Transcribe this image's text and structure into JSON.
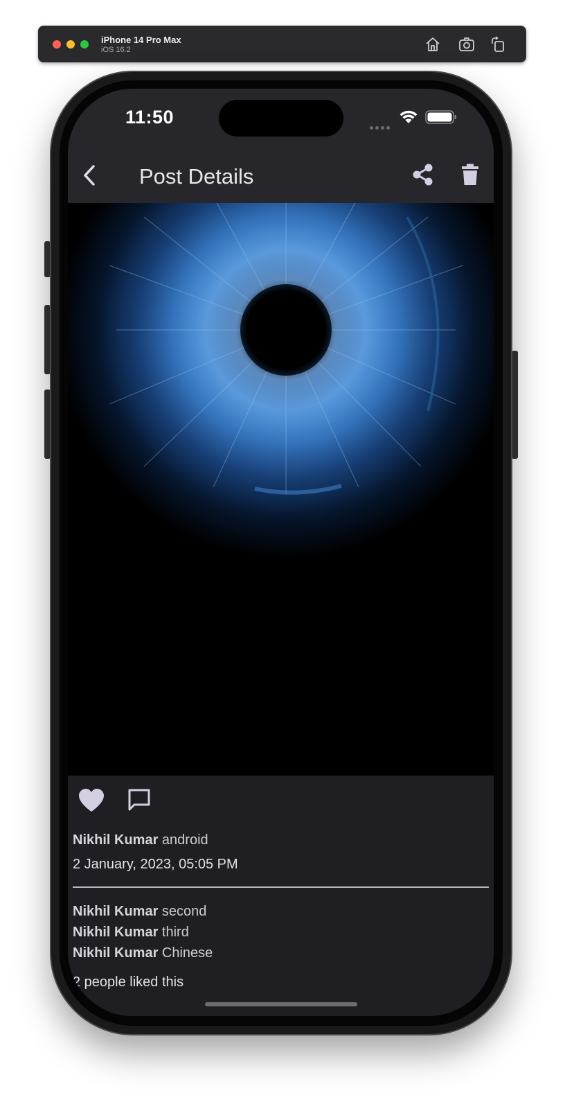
{
  "simulator": {
    "device_name": "iPhone 14 Pro Max",
    "os_version": "iOS 16.2",
    "buttons": [
      "home-icon",
      "screenshot-icon",
      "rotate-icon"
    ]
  },
  "status_bar": {
    "time": "11:50",
    "icons": [
      "cellular-icon",
      "wifi-icon",
      "battery-icon"
    ]
  },
  "app_bar": {
    "title": "Post Details",
    "back_icon": "chevron-left-icon",
    "actions": [
      "share-icon",
      "trash-icon"
    ]
  },
  "post": {
    "image": "blue-eye-iris-image",
    "author": "Nikhil Kumar",
    "caption": "android",
    "date": "2 January, 2023, 05:05 PM",
    "comments": [
      {
        "author": "Nikhil Kumar",
        "text": "second"
      },
      {
        "author": "Nikhil Kumar",
        "text": "third"
      },
      {
        "author": "Nikhil Kumar",
        "text": "Chinese"
      }
    ],
    "likes_text": "2 people liked this"
  },
  "colors": {
    "app_bar_bg": "#27262b",
    "screen_bg": "#1f1e23",
    "icon_tint": "#d4cfe0",
    "text": "#cfccd4"
  }
}
